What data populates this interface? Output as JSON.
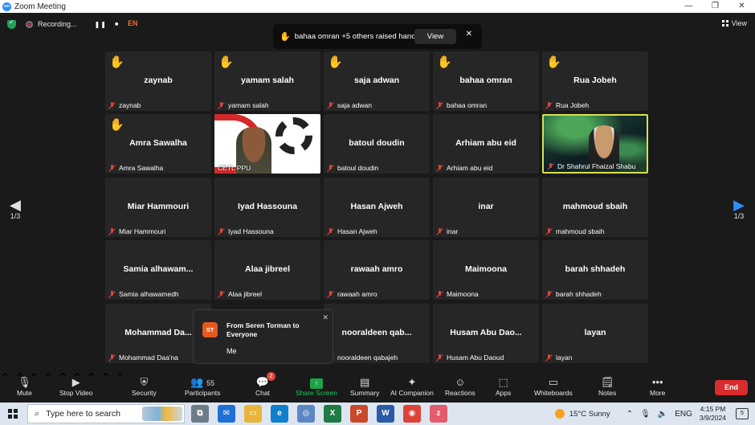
{
  "window": {
    "title": "Zoom Meeting",
    "minimize": "—",
    "maximize": "❐",
    "close": "✕"
  },
  "topbar": {
    "recording_label": "Recording...",
    "pause_glyph": "❚❚",
    "stop_glyph": "■",
    "language": "EN",
    "view_label": "View"
  },
  "hands_notice": {
    "icon": "✋",
    "text": "bahaa omran +5 others raised hands",
    "view_button": "View",
    "close_glyph": "✕"
  },
  "pagination": {
    "left": "1/3",
    "right": "1/3",
    "left_arrow": "◀",
    "right_arrow": "▶"
  },
  "participants": [
    {
      "name": "zaynab",
      "label": "zaynab",
      "hand": "✋"
    },
    {
      "name": "yamam salah",
      "label": "yamam salah",
      "hand": "✋"
    },
    {
      "name": "saja adwan",
      "label": "saja adwan",
      "hand": "✋"
    },
    {
      "name": "bahaa omran",
      "label": "bahaa omran",
      "hand": "✋"
    },
    {
      "name": "Rua Jobeh",
      "label": "Rua Jobeh",
      "hand": "✋"
    },
    {
      "name": "Amra Sawalha",
      "label": "Amra Sawalha",
      "hand": "✋"
    },
    {
      "name": "",
      "label": "CETL PPU",
      "hand": ""
    },
    {
      "name": "batoul doudin",
      "label": "batoul doudin",
      "hand": ""
    },
    {
      "name": "Arhiam abu eid",
      "label": "Arhiam abu eid",
      "hand": ""
    },
    {
      "name": "",
      "label": "Dr Shahrul Fhaizal Shabu",
      "hand": ""
    },
    {
      "name": "Miar Hammouri",
      "label": "Miar Hammouri",
      "hand": ""
    },
    {
      "name": "Iyad Hassouna",
      "label": "Iyad Hassouna",
      "hand": ""
    },
    {
      "name": "Hasan Ajweh",
      "label": "Hasan Ajweh",
      "hand": ""
    },
    {
      "name": "inar",
      "label": "inar",
      "hand": ""
    },
    {
      "name": "mahmoud sbaih",
      "label": "mahmoud sbaih",
      "hand": ""
    },
    {
      "name": "Samia  alhawam...",
      "label": "Samia alhawamedh",
      "hand": ""
    },
    {
      "name": "Alaa jibreel",
      "label": "Alaa jibreel",
      "hand": ""
    },
    {
      "name": "rawaah amro",
      "label": "rawaah amro",
      "hand": ""
    },
    {
      "name": "Maimoona",
      "label": "Maimoona",
      "hand": ""
    },
    {
      "name": "barah shhadeh",
      "label": "barah shhadeh",
      "hand": ""
    },
    {
      "name": "Mohammad  Da...",
      "label": "Mohammad Daa'na",
      "hand": ""
    },
    {
      "name": "",
      "label": "",
      "hand": ""
    },
    {
      "name": "nooraldeen  qab...",
      "label": "nooraldeen qabajeh",
      "hand": ""
    },
    {
      "name": "Husam  Abu  Dao...",
      "label": "Husam Abu Daoud",
      "hand": ""
    },
    {
      "name": "layan",
      "label": "layan",
      "hand": ""
    }
  ],
  "chat_popup": {
    "avatar_initials": "ST",
    "from": "From Seren Torman to Everyone",
    "message": "Me",
    "close_glyph": "✕"
  },
  "toolbar": {
    "mute": "Mute",
    "stop_video": "Stop Video",
    "security": "Security",
    "participants": "Participants",
    "participants_count": "55",
    "chat": "Chat",
    "chat_badge": "2",
    "share_screen": "Share Screen",
    "summary": "Summary",
    "ai_companion": "AI Companion",
    "reactions": "Reactions",
    "apps": "Apps",
    "whiteboards": "Whiteboards",
    "notes": "Notes",
    "more": "More",
    "end": "End"
  },
  "taskbar": {
    "search_placeholder": "Type here to search",
    "weather": "15°C  Sunny",
    "language": "ENG",
    "time": "4:15 PM",
    "date": "3/9/2024",
    "notification_count": "5"
  }
}
